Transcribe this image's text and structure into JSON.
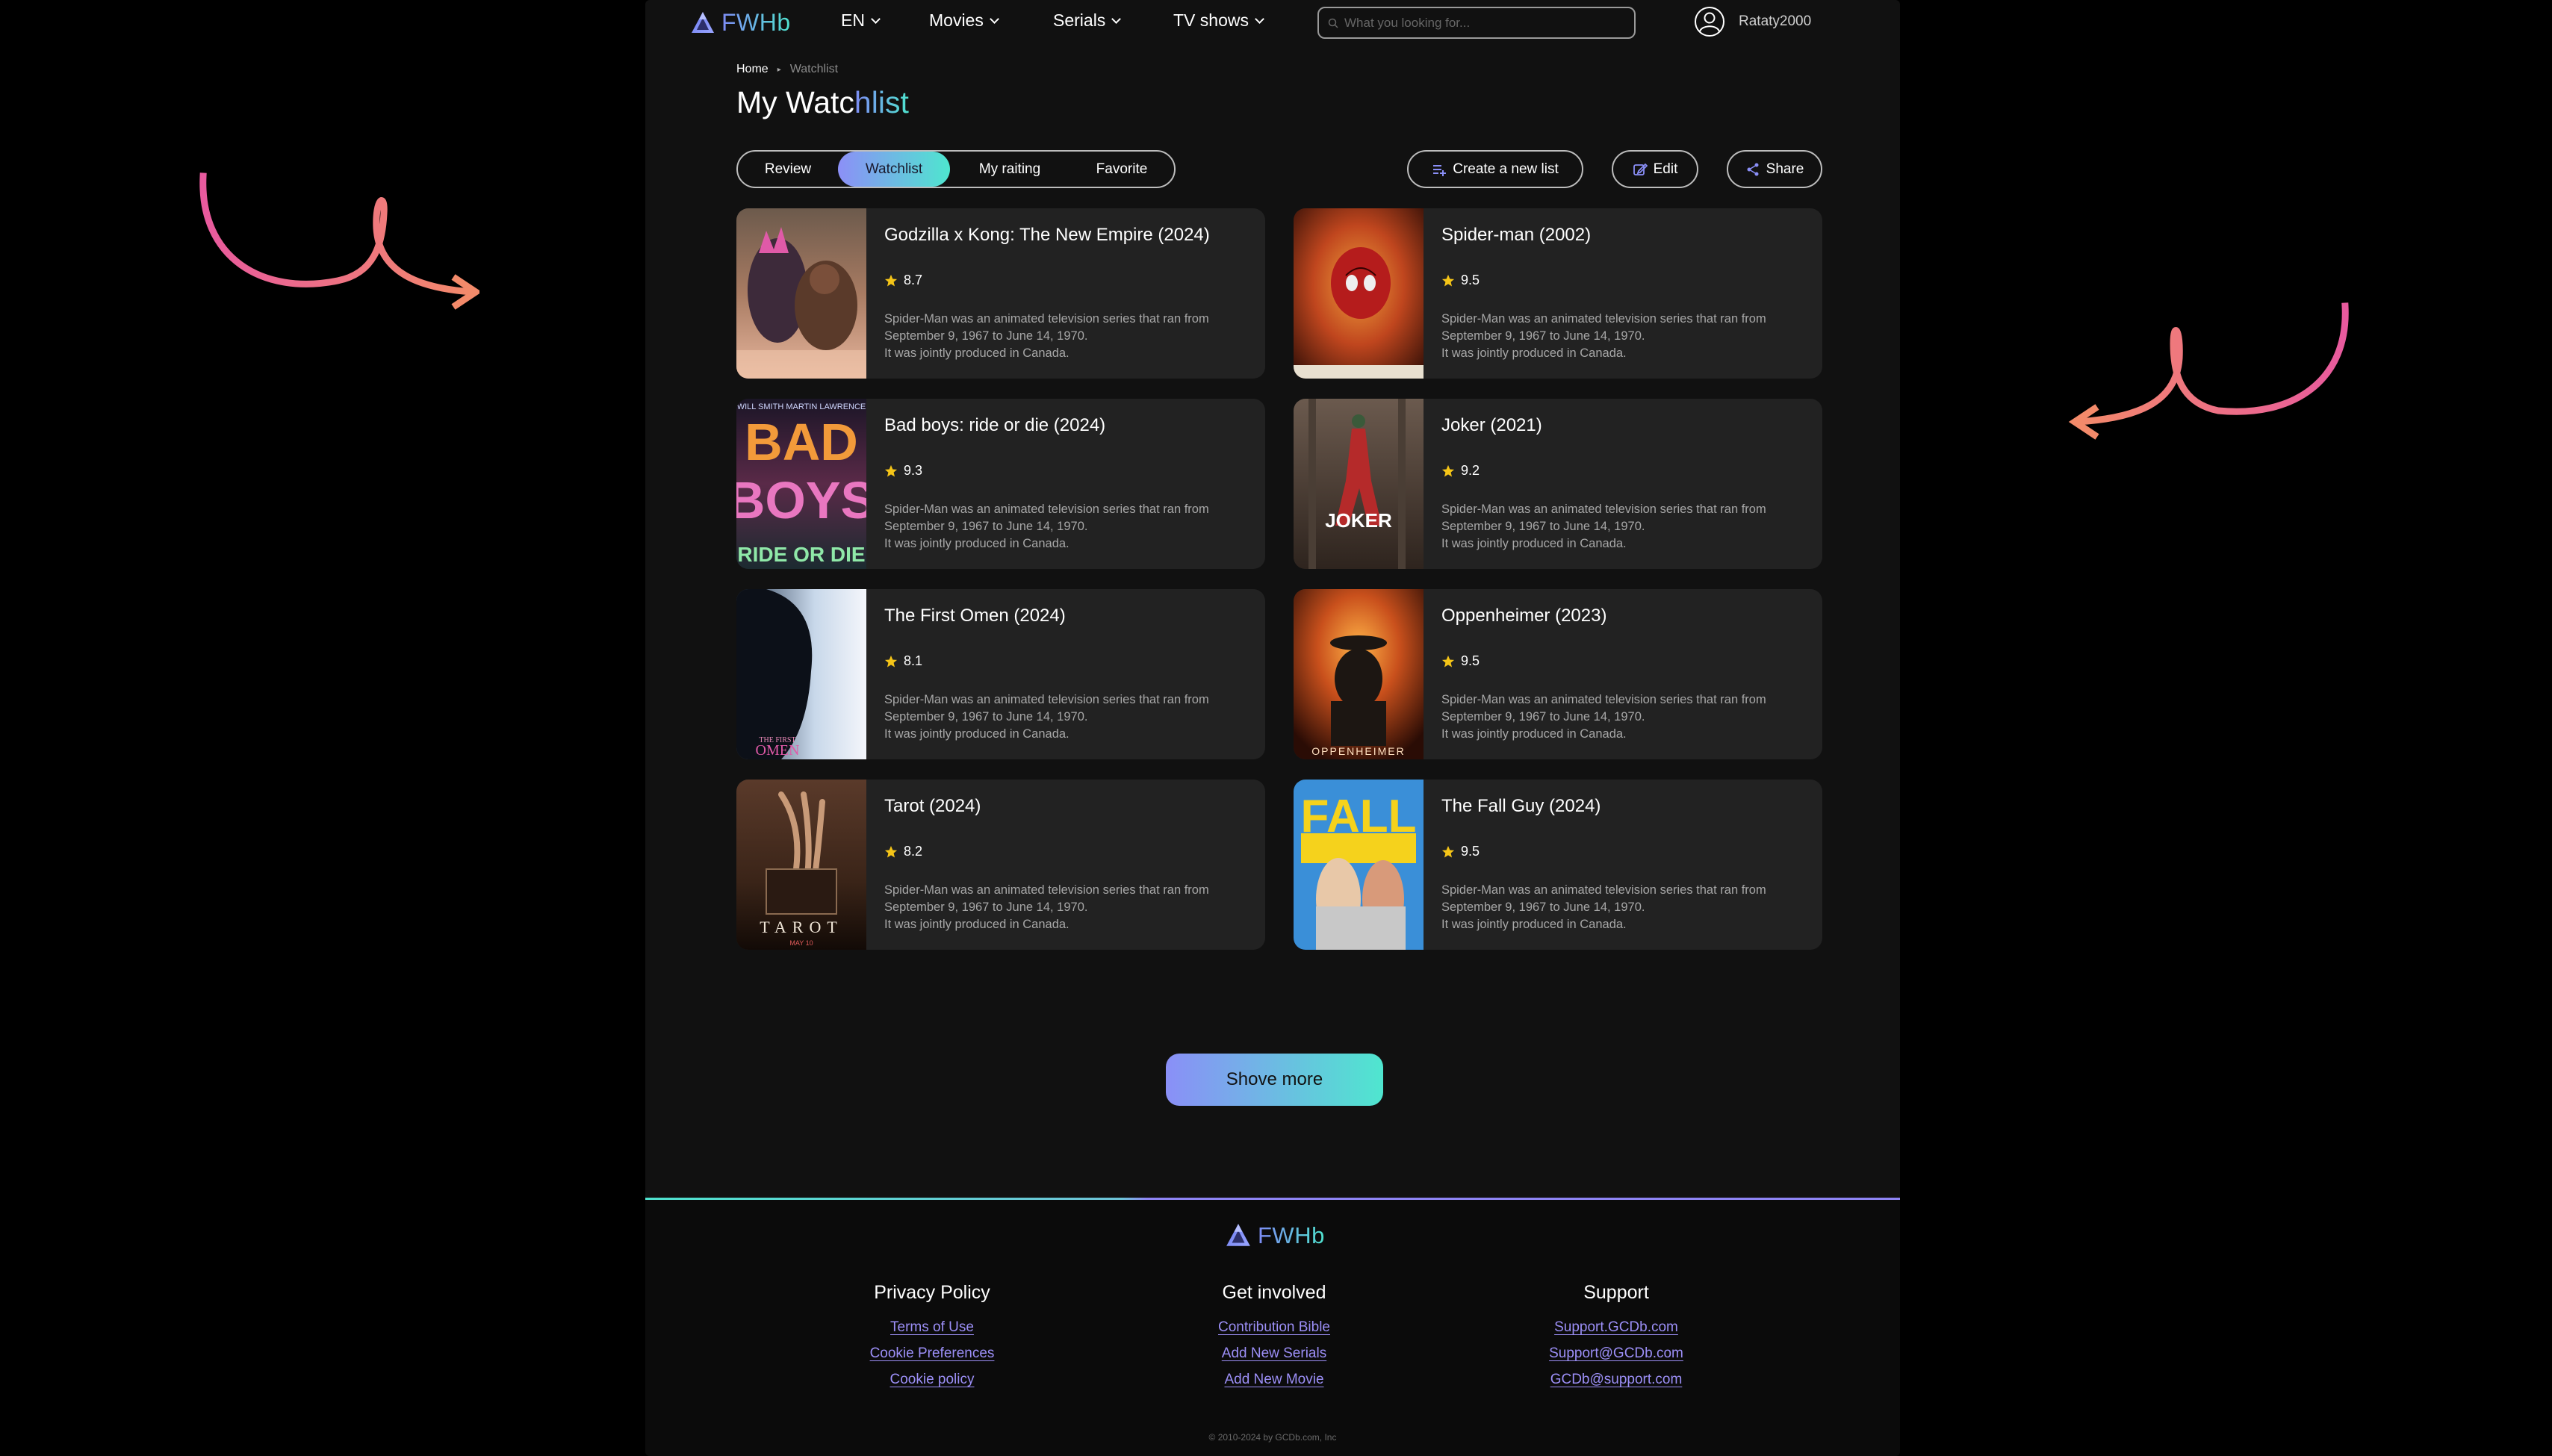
{
  "header": {
    "logo_text": "FWHb",
    "nav": [
      {
        "label": "EN"
      },
      {
        "label": "Movies"
      },
      {
        "label": "Serials"
      },
      {
        "label": "TV shows"
      }
    ],
    "search_placeholder": "What you looking for...",
    "username": "Rataty2000"
  },
  "breadcrumb": {
    "home": "Home",
    "current": "Watchlist"
  },
  "title": {
    "part1": "My Watc",
    "part2": "hlist"
  },
  "tabs": [
    {
      "label": "Review"
    },
    {
      "label": "Watchlist",
      "active": true
    },
    {
      "label": "My raiting"
    },
    {
      "label": "Favorite"
    }
  ],
  "actions": {
    "create": "Create a new list",
    "edit": "Edit",
    "share": "Share"
  },
  "cards": [
    {
      "title": "Godzilla x Kong: The New Empire (2024)",
      "rating": "8.7",
      "desc": "Spider-Man was an animated television series that ran from\nSeptember 9, 1967 to June 14, 1970.\n It was jointly produced in Canada."
    },
    {
      "title": "Spider-man (2002)",
      "rating": "9.5",
      "desc": "Spider-Man was an animated television series that ran from\nSeptember 9, 1967 to June 14, 1970.\n It was jointly produced in Canada."
    },
    {
      "title": "Bad boys: ride or  die (2024)",
      "rating": "9.3",
      "desc": "Spider-Man was an animated television series that ran from\nSeptember 9, 1967 to June 14, 1970.\n It was jointly produced in Canada."
    },
    {
      "title": "Joker (2021)",
      "rating": "9.2",
      "desc": "Spider-Man was an animated television series that ran from\nSeptember 9, 1967 to June 14, 1970.\nIt was jointly produced in Canada."
    },
    {
      "title": "The First Omen (2024)",
      "rating": "8.1",
      "desc": "Spider-Man was an animated television series that ran from\nSeptember 9, 1967 to June 14, 1970.\n It was jointly produced in Canada."
    },
    {
      "title": "Oppenheimer (2023)",
      "rating": "9.5",
      "desc": "Spider-Man was an animated television series that ran from\nSeptember 9, 1967 to June 14, 1970.\nIt was jointly produced in Canada."
    },
    {
      "title": "Tarot (2024)",
      "rating": "8.2",
      "desc": "Spider-Man was an animated television series that ran from\nSeptember 9, 1967 to June 14, 1970.\n It was jointly produced in Canada."
    },
    {
      "title": "The Fall Guy (2024)",
      "rating": "9.5",
      "desc": "Spider-Man was an animated television series that ran from\nSeptember 9, 1967 to June 14, 1970.\nIt was jointly produced in Canada."
    }
  ],
  "posters": [
    {
      "text": ""
    },
    {
      "text": ""
    },
    {
      "text": "WILL SMITH   MARTIN LAWRENCE",
      "big1": "BAD",
      "big2": "BOYS",
      "sub": "RIDE OR DIE"
    },
    {
      "text": "JOKER"
    },
    {
      "text": "THE FIRST",
      "sub": "OMEN"
    },
    {
      "text": "OPPENHEIMER"
    },
    {
      "text": "TAROT",
      "sub": "MAY 10"
    },
    {
      "text": "FALL"
    }
  ],
  "show_more": "Shove more",
  "footer": {
    "logo_text": "FWHb",
    "columns": [
      {
        "title": "Privacy Policy",
        "links": [
          "Terms of Use",
          "Cookie Preferences",
          "Cookie policy"
        ]
      },
      {
        "title": "Get involved",
        "links": [
          "Contribution Bible",
          "Add New Serials",
          "Add New Movie"
        ]
      },
      {
        "title": "Support",
        "links": [
          "Support.GCDb.com",
          "Support@GCDb.com",
          "GCDb@support.com"
        ]
      }
    ],
    "copyright": "© 2010-2024 by GCDb.com, Inc"
  },
  "colors": {
    "accent_start": "#8a8ff7",
    "accent_end": "#4fe6cf",
    "card_bg": "#222222",
    "star": "#f5c518"
  }
}
